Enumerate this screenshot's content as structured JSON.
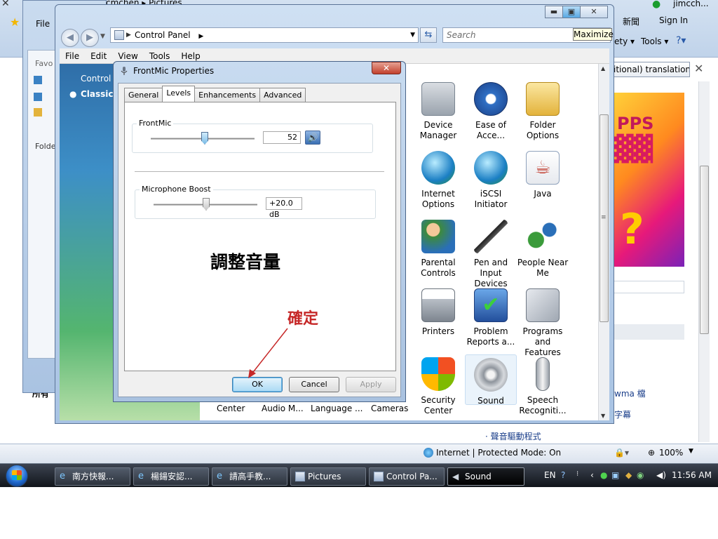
{
  "ie": {
    "top_user": "jimcch...",
    "toolbar_links": [
      "新聞",
      "Sign In",
      "ety ▾",
      "Tools ▾"
    ],
    "translate_button": "itional) translation",
    "right_links": [
      "wma 檔",
      "字幕",
      "· 聲音驅動程式"
    ],
    "bottom_left_text": "所有",
    "status_text": "Internet | Protected Mode: On",
    "zoom": "100%"
  },
  "pictures_window": {
    "title": "cmchen ▸ Pictures",
    "menu_file": "File",
    "favorites": "Favo",
    "folders": "Folde"
  },
  "control_panel": {
    "address": "Control Panel",
    "search_placeholder": "Search",
    "tooltip": "Maximize",
    "menu": [
      "File",
      "Edit",
      "View",
      "Tools",
      "Help"
    ],
    "left_links": [
      "Control P",
      "Classic V"
    ],
    "items": [
      {
        "label": "Device Manager",
        "icon": "device-manager-icon"
      },
      {
        "label": "Ease of Acce...",
        "icon": "ease-of-access-icon"
      },
      {
        "label": "Folder Options",
        "icon": "folder-options-icon"
      },
      {
        "label": "Internet Options",
        "icon": "internet-options-icon"
      },
      {
        "label": "iSCSI Initiator",
        "icon": "iscsi-initiator-icon"
      },
      {
        "label": "Java",
        "icon": "java-icon"
      },
      {
        "label": "Parental Controls",
        "icon": "parental-controls-icon"
      },
      {
        "label": "Pen and Input Devices",
        "icon": "pen-input-icon"
      },
      {
        "label": "People Near Me",
        "icon": "people-near-me-icon"
      },
      {
        "label": "Printers",
        "icon": "printers-icon"
      },
      {
        "label": "Problem Reports a...",
        "icon": "problem-reports-icon"
      },
      {
        "label": "Programs and Features",
        "icon": "programs-features-icon"
      },
      {
        "label": "Security Center",
        "icon": "security-center-icon"
      },
      {
        "label": "Sound",
        "icon": "sound-icon"
      },
      {
        "label": "Speech Recogniti...",
        "icon": "speech-recognition-icon"
      }
    ],
    "partial_labels": [
      "A",
      "d",
      "d"
    ],
    "bottom_row": [
      "Center",
      "Audio M...",
      "Language ...",
      "Cameras"
    ]
  },
  "dialog": {
    "title": "FrontMic Properties",
    "tabs": [
      "General",
      "Levels",
      "Enhancements",
      "Advanced"
    ],
    "active_tab": "Levels",
    "frontmic_label": "FrontMic",
    "frontmic_value": "52",
    "boost_label": "Microphone Boost",
    "boost_value": "+20.0 dB",
    "note": "調整音量",
    "ok": "OK",
    "cancel": "Cancel",
    "apply": "Apply"
  },
  "annotation": {
    "text": "確定",
    "color": "#c62828"
  },
  "taskbar": {
    "tasks": [
      {
        "label": "南方快報...",
        "icon": "ie-icon"
      },
      {
        "label": "楊鍚安認...",
        "icon": "ie-icon"
      },
      {
        "label": "請高手教...",
        "icon": "ie-icon"
      },
      {
        "label": "Pictures",
        "icon": "folder-icon"
      },
      {
        "label": "Control Pa...",
        "icon": "control-panel-icon"
      },
      {
        "label": "Sound",
        "icon": "speaker-icon"
      }
    ],
    "lang": "EN",
    "clock": "11:56 AM"
  },
  "colors": {
    "accent": "#3c7fb1",
    "taskbar": "#1b2029"
  }
}
